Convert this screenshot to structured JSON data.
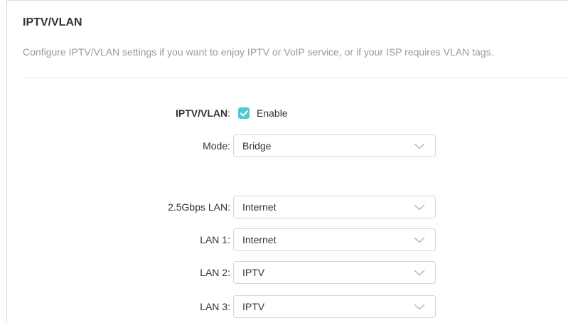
{
  "section": {
    "title": "IPTV/VLAN",
    "description": "Configure IPTV/VLAN settings if you want to enjoy IPTV or VoIP service, or if your ISP requires VLAN tags."
  },
  "form": {
    "iptv_vlan": {
      "label": "IPTV/VLAN",
      "colon": ":",
      "checkbox_label": "Enable",
      "checked": true
    },
    "mode": {
      "label": "Mode:",
      "value": "Bridge"
    },
    "ports": [
      {
        "label": "2.5Gbps LAN:",
        "value": "Internet"
      },
      {
        "label": "LAN 1:",
        "value": "Internet"
      },
      {
        "label": "LAN 2:",
        "value": "IPTV"
      },
      {
        "label": "LAN 3:",
        "value": "IPTV"
      }
    ]
  },
  "colors": {
    "accent": "#4acbd6",
    "text": "#333333",
    "muted": "#999999",
    "border": "#d6d6d6"
  },
  "icons": {
    "checkbox": "check-icon",
    "dropdown": "chevron-down-icon"
  }
}
